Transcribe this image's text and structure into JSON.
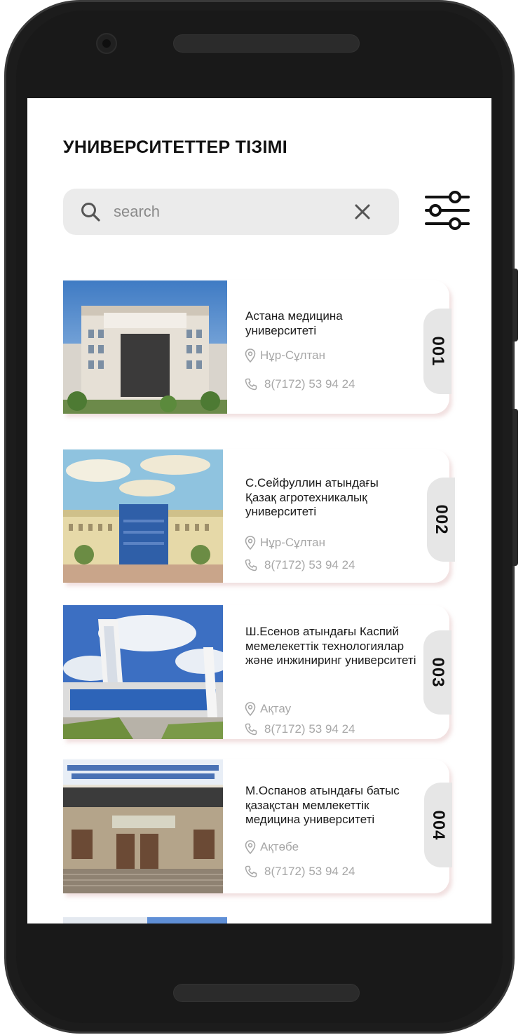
{
  "header": {
    "title": "УНИВЕРСИТЕТТЕР ТІЗІМІ"
  },
  "search": {
    "placeholder": "search",
    "value": ""
  },
  "universities": [
    {
      "number": "001",
      "name": "Астана медицина университеті",
      "city": "Нұр-Сұлтан",
      "phone": "8(7172) 53 94 24"
    },
    {
      "number": "002",
      "name": "С.Сейфуллин атындағы Қазақ агротехникалық университеті",
      "city": "Нұр-Сұлтан",
      "phone": "8(7172) 53 94 24"
    },
    {
      "number": "003",
      "name": "Ш.Есенов атындағы Каспий мемелекеттік технологиялар және инжиниринг университеті",
      "city": "Ақтау",
      "phone": "8(7172) 53 94 24"
    },
    {
      "number": "004",
      "name": "М.Оспанов атындағы батыс қазақстан мемлекеттік медицина университеті",
      "city": "Ақтөбе",
      "phone": "8(7172) 53 94 24"
    }
  ],
  "colors": {
    "accent_text": "#111111",
    "muted_text": "#a7a7a7",
    "search_bg": "#ebebeb",
    "tab_bg": "#e6e6e6"
  },
  "icons": {
    "search": "search-icon",
    "clear": "close-icon",
    "filter": "sliders-icon",
    "location": "location-pin-icon",
    "phone": "phone-icon"
  }
}
